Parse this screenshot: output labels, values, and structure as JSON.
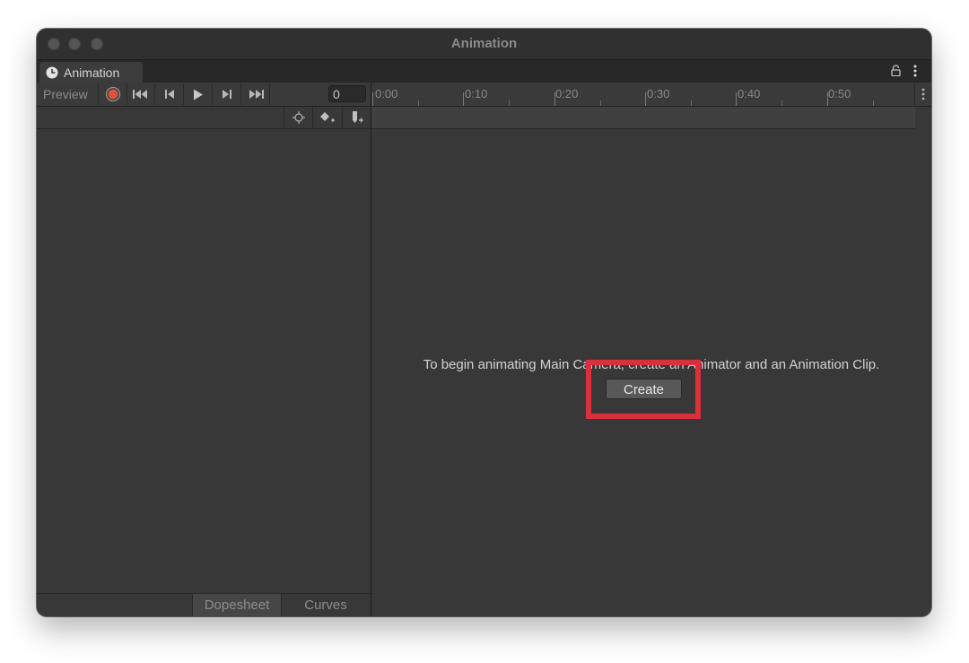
{
  "window": {
    "title": "Animation"
  },
  "tab": {
    "label": "Animation"
  },
  "toolbar": {
    "preview_label": "Preview",
    "frame_value": "0"
  },
  "ruler": {
    "labels": [
      "0:00",
      "0:10",
      "0:20",
      "0:30",
      "0:40",
      "0:50"
    ]
  },
  "bottom_tabs": {
    "dopesheet": "Dopesheet",
    "curves": "Curves"
  },
  "main": {
    "message": "To begin animating Main Camera, create an Animator and an Animation Clip.",
    "create_label": "Create"
  },
  "colors": {
    "record": "#d9553a",
    "highlight": "#d9303a",
    "background": "#383838"
  },
  "icons": {
    "tab": "clock-icon",
    "lock": "lock-icon",
    "menu": "kebab-menu-icon",
    "record": "record-icon",
    "first_key": "first-key-icon",
    "prev_key": "previous-key-icon",
    "play": "play-icon",
    "next_key": "next-key-icon",
    "last_key": "last-key-icon",
    "filter": "crosshair-icon",
    "add_keyframe": "add-keyframe-icon",
    "add_event": "add-event-icon"
  }
}
